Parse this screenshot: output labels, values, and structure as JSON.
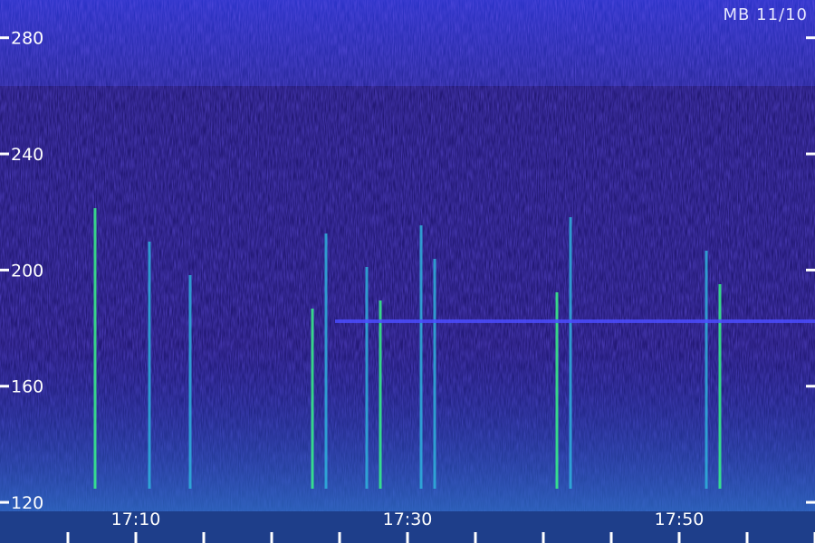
{
  "chart_data": {
    "type": "heatmap",
    "title": "",
    "stamp": "MB 11/10",
    "xlabel": "",
    "ylabel": "",
    "x_ticks": [
      "17:10",
      "17:30",
      "17:50"
    ],
    "y_ticks": [
      120,
      160,
      200,
      240,
      280
    ],
    "ylim": [
      106,
      293
    ],
    "colormap": [
      "#1a0d5a",
      "#2b1fb0",
      "#3a4cff",
      "#2fa8d8",
      "#36ff80"
    ],
    "features": {
      "horizontal_band_y": 183,
      "bright_vertical_times": [
        "17:07",
        "17:11",
        "17:14",
        "17:23",
        "17:24",
        "17:27",
        "17:28",
        "17:31",
        "17:32",
        "17:41",
        "17:42",
        "17:52",
        "17:53"
      ]
    }
  }
}
